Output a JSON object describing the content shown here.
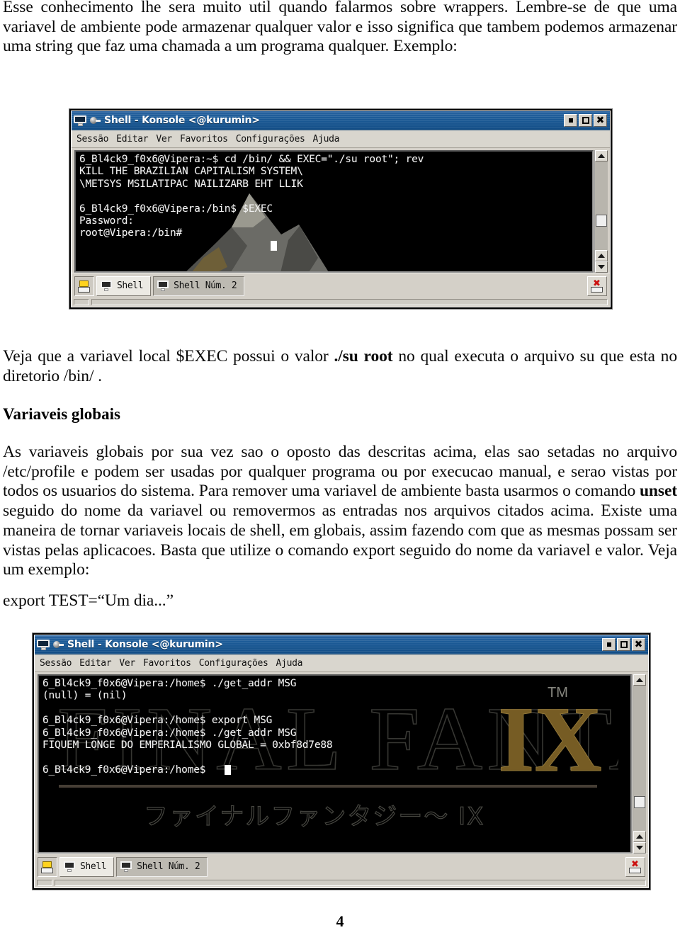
{
  "document": {
    "page_number": "4",
    "paragraph_1": "Esse conhecimento lhe sera muito util quando falarmos sobre wrappers. Lembre-se de que uma variavel de ambiente pode armazenar qualquer valor e isso significa que tambem podemos armazenar uma string que faz uma chamada a um programa qualquer. Exemplo:",
    "paragraph_2_part1": "Veja que a variavel local $EXEC possui o valor ",
    "paragraph_2_bold": "./su root",
    "paragraph_2_part2": " no qual executa o arquivo su que esta no diretorio /bin/ .",
    "heading_globais": "Variaveis globais",
    "paragraph_3_part1": "As variaveis globais por sua vez sao o oposto das descritas acima, elas sao setadas no arquivo /etc/profile e podem ser usadas por qualquer programa ou por execucao manual, e serao vistas por todos os usuarios do sistema. Para remover uma variavel de ambiente basta usarmos o comando ",
    "paragraph_3_bold": "unset",
    "paragraph_3_part2": " seguido do nome da variavel ou removermos as entradas nos arquivos citados acima.  Existe uma maneira de tornar variaveis locais de shell, em globais, assim fazendo com que as mesmas possam ser vistas pelas aplicacoes. Basta que utilize o comando export seguido do nome da variavel e valor. Veja um exemplo:",
    "paragraph_4": "export TEST=“Um dia...”"
  },
  "terminal_1": {
    "title": "Shell - Konsole <@kurumin>",
    "icons": {
      "monitor": "monitor-icon",
      "pin": "pin-icon"
    },
    "window_buttons": {
      "minimize": "minimize-button",
      "maximize": "maximize-button",
      "close": "close-button"
    },
    "menu": [
      "Sessão",
      "Editar",
      "Ver",
      "Favoritos",
      "Configurações",
      "Ajuda"
    ],
    "content": "6_Bl4ck9_f0x6@Vipera:~$ cd /bin/ && EXEC=\"./su root\"; rev\nKILL THE BRAZILIAN CAPITALISM SYSTEM\\\n\\METSYS MSILATIPAC NAILIZARB EHT LLIK\n\n6_Bl4ck9_f0x6@Vipera:/bin$ $EXEC\nPassword:\nroot@Vipera:/bin#",
    "watermark": "mountain-watermark",
    "tabs": [
      {
        "label": "Shell",
        "active": false
      },
      {
        "label": "Shell Núm. 2",
        "active": true
      }
    ],
    "toolbar": {
      "new_session": "new-session-button",
      "close_session": "close-session-button"
    }
  },
  "terminal_2": {
    "title": "Shell - Konsole <@kurumin>",
    "icons": {
      "monitor": "monitor-icon",
      "pin": "pin-icon"
    },
    "window_buttons": {
      "minimize": "minimize-button",
      "maximize": "maximize-button",
      "close": "close-button"
    },
    "menu": [
      "Sessão",
      "Editar",
      "Ver",
      "Favoritos",
      "Configurações",
      "Ajuda"
    ],
    "content": "6_Bl4ck9_f0x6@Vipera:/home$ ./get_addr MSG\n(null) = (nil)\n\n6_Bl4ck9_f0x6@Vipera:/home$ export MSG\n6_Bl4ck9_f0x6@Vipera:/home$ ./get_addr MSG\nFIQUEM LONGE DO EMPERIALISMO GLOBAL = 0xbf8d7e88\n\n6_Bl4ck9_f0x6@Vipera:/home$",
    "watermark": {
      "name": "final-fantasy-ix-watermark",
      "line_main": "FINAL FANTASY IX",
      "trademark": "TM",
      "line_jp": "ファイナルファンタジー IX"
    },
    "tabs": [
      {
        "label": "Shell",
        "active": false
      },
      {
        "label": "Shell Núm. 2",
        "active": true
      }
    ],
    "toolbar": {
      "new_session": "new-session-button",
      "close_session": "close-session-button"
    }
  },
  "colors": {
    "titlebar_blue": "#1c5b98",
    "chrome_gray": "#d4d0c8",
    "terminal_bg": "#000000",
    "terminal_fg": "#f2f2f2",
    "ffix_gold": "#9a7e3c"
  }
}
